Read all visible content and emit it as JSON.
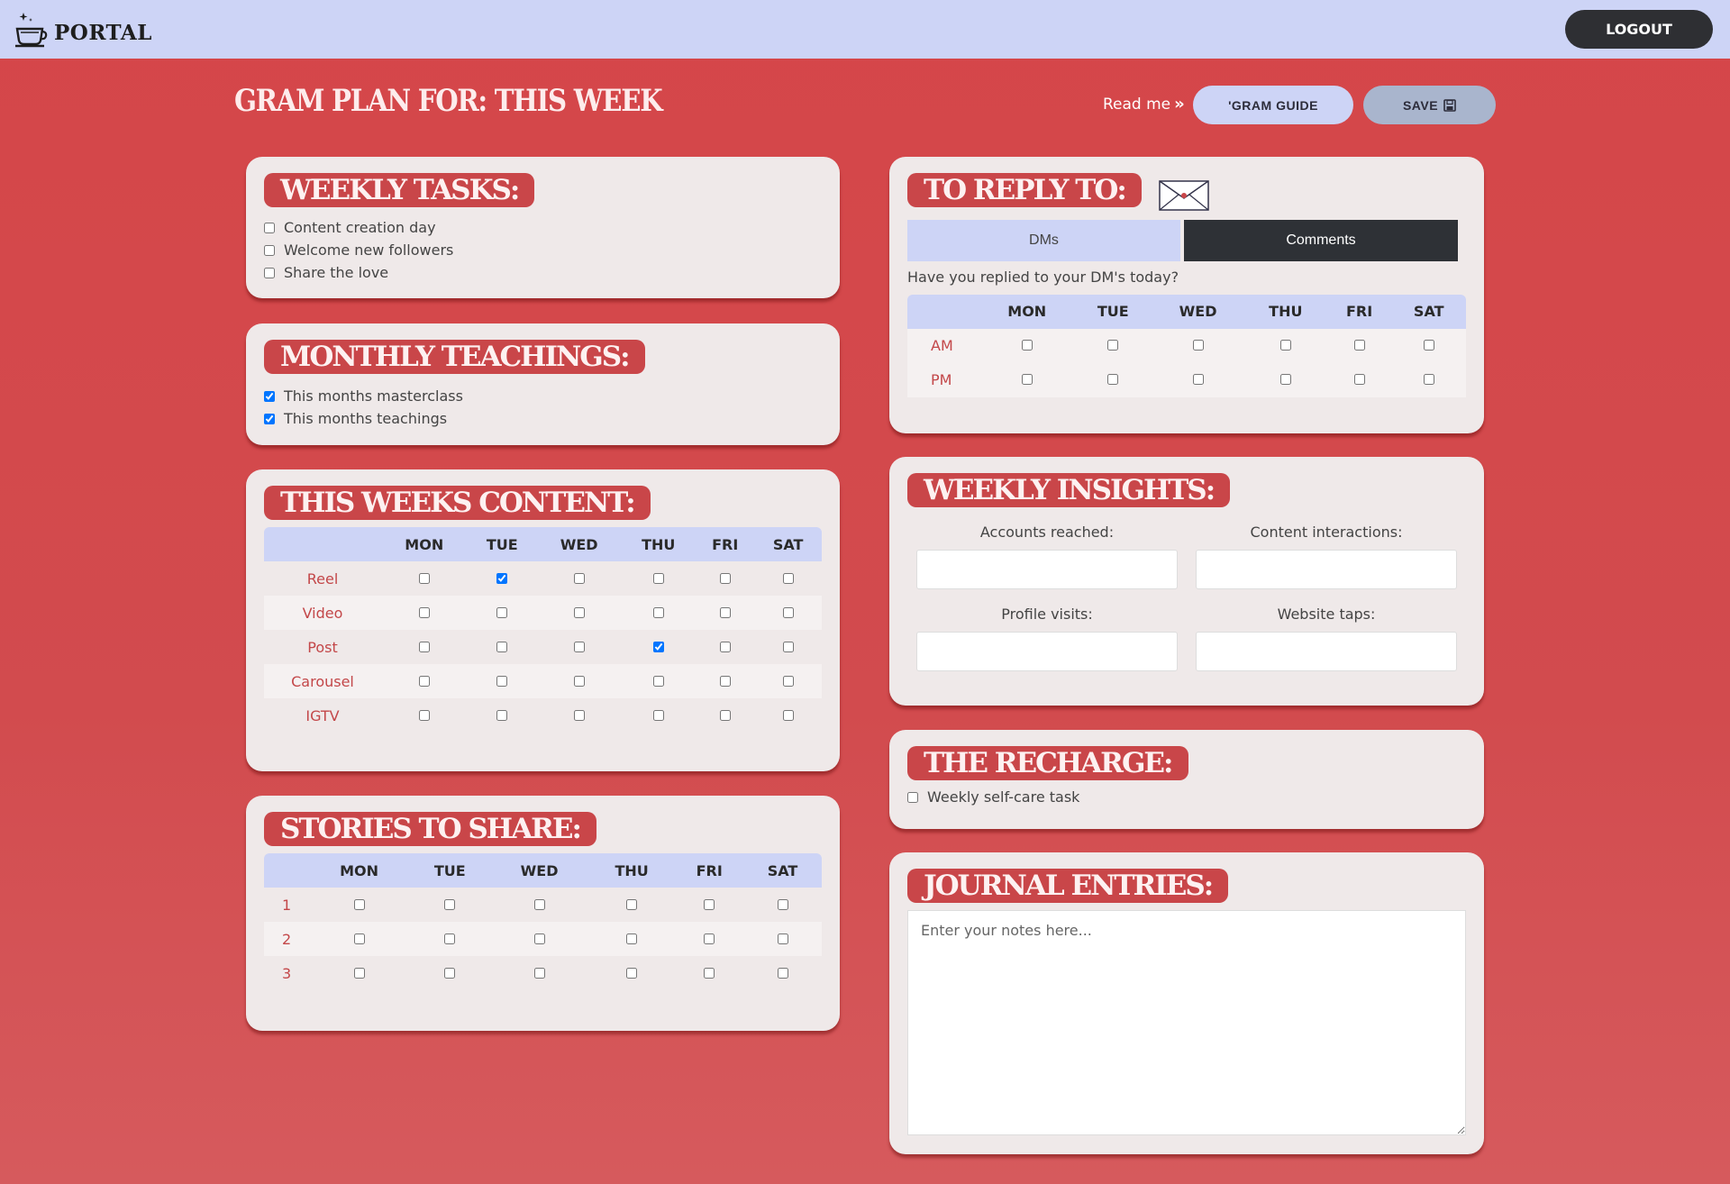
{
  "topbar": {
    "logo_text": "PORTAL",
    "logout_label": "LOGOUT"
  },
  "header": {
    "title": "GRAM PLAN FOR: THIS WEEK",
    "readme_label": "Read me",
    "guide_label": "'GRAM GUIDE",
    "save_label": "SAVE"
  },
  "weekly_tasks": {
    "title": "WEEKLY TASKS:",
    "items": [
      {
        "label": "Content creation day",
        "checked": false
      },
      {
        "label": "Welcome new followers",
        "checked": false
      },
      {
        "label": "Share the love",
        "checked": false
      }
    ]
  },
  "monthly_teachings": {
    "title": "MONTHLY TEACHINGS:",
    "items": [
      {
        "label": "This months masterclass",
        "checked": true
      },
      {
        "label": "This months teachings",
        "checked": true
      }
    ]
  },
  "weeks_content": {
    "title": "THIS WEEKS CONTENT:",
    "days": [
      "MON",
      "TUE",
      "WED",
      "THU",
      "FRI",
      "SAT"
    ],
    "rows": [
      {
        "label": "Reel",
        "checks": [
          false,
          true,
          false,
          false,
          false,
          false
        ]
      },
      {
        "label": "Video",
        "checks": [
          false,
          false,
          false,
          false,
          false,
          false
        ]
      },
      {
        "label": "Post",
        "checks": [
          false,
          false,
          false,
          true,
          false,
          false
        ]
      },
      {
        "label": "Carousel",
        "checks": [
          false,
          false,
          false,
          false,
          false,
          false
        ]
      },
      {
        "label": "IGTV",
        "checks": [
          false,
          false,
          false,
          false,
          false,
          false
        ]
      }
    ]
  },
  "stories": {
    "title": "STORIES TO SHARE:",
    "days": [
      "MON",
      "TUE",
      "WED",
      "THU",
      "FRI",
      "SAT"
    ],
    "rows": [
      {
        "label": "1",
        "checks": [
          false,
          false,
          false,
          false,
          false,
          false
        ]
      },
      {
        "label": "2",
        "checks": [
          false,
          false,
          false,
          false,
          false,
          false
        ]
      },
      {
        "label": "3",
        "checks": [
          false,
          false,
          false,
          false,
          false,
          false
        ]
      }
    ]
  },
  "reply": {
    "title": "TO REPLY TO:",
    "tabs": [
      "DMs",
      "Comments"
    ],
    "active_tab": "Comments",
    "question": "Have you replied to your DM's today?",
    "days": [
      "MON",
      "TUE",
      "WED",
      "THU",
      "FRI",
      "SAT"
    ],
    "rows": [
      {
        "label": "AM",
        "checks": [
          false,
          false,
          false,
          false,
          false,
          false
        ]
      },
      {
        "label": "PM",
        "checks": [
          false,
          false,
          false,
          false,
          false,
          false
        ]
      }
    ]
  },
  "insights": {
    "title": "WEEKLY INSIGHTS:",
    "fields": [
      {
        "label": "Accounts reached:",
        "value": ""
      },
      {
        "label": "Content interactions:",
        "value": ""
      },
      {
        "label": "Profile visits:",
        "value": ""
      },
      {
        "label": "Website taps:",
        "value": ""
      }
    ]
  },
  "recharge": {
    "title": "THE RECHARGE:",
    "items": [
      {
        "label": "Weekly self-care task",
        "checked": false
      }
    ]
  },
  "journal": {
    "title": "JOURNAL ENTRIES:",
    "placeholder": "Enter your notes here...",
    "value": ""
  },
  "colors": {
    "background": "#d24a4d",
    "topbar": "#cdd4f6",
    "card": "#efe9e9",
    "title_badge": "#c94649",
    "dark_button": "#2e2f33",
    "row_label": "#c34749"
  }
}
